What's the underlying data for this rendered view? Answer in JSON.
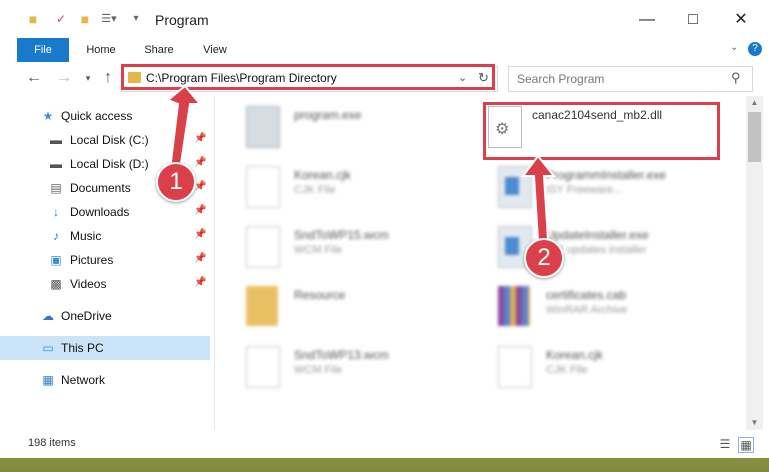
{
  "window": {
    "title": "Program"
  },
  "ribbon": {
    "tabs": [
      "File",
      "Home",
      "Share",
      "View"
    ]
  },
  "address": {
    "path": "C:\\Program Files\\Program Directory"
  },
  "search": {
    "placeholder": "Search Program"
  },
  "sidebar": {
    "items": [
      {
        "label": "Quick access",
        "icon": "star-icon"
      },
      {
        "label": "Local Disk (C:)",
        "icon": "drive-icon"
      },
      {
        "label": "Local Disk (D:)",
        "icon": "drive-icon"
      },
      {
        "label": "Documents",
        "icon": "document-icon"
      },
      {
        "label": "Downloads",
        "icon": "download-arrow-icon"
      },
      {
        "label": "Music",
        "icon": "music-note-icon"
      },
      {
        "label": "Pictures",
        "icon": "picture-icon"
      },
      {
        "label": "Videos",
        "icon": "video-icon"
      },
      {
        "label": "OneDrive",
        "icon": "cloud-icon"
      },
      {
        "label": "This PC",
        "icon": "monitor-icon"
      },
      {
        "label": "Network",
        "icon": "network-icon"
      }
    ]
  },
  "files": [
    {
      "name": "program.exe",
      "type": ""
    },
    {
      "name": "canac2104send_mb2.dll",
      "type": ""
    },
    {
      "name": "Korean.cjk",
      "type": "CJK File"
    },
    {
      "name": "ProgrammInstaller.exe",
      "type": "ISY Freeware..."
    },
    {
      "name": "SndToWP15.wcm",
      "type": "WCM File"
    },
    {
      "name": "UpdateInstaller.exe",
      "type": "ISY updates installer"
    },
    {
      "name": "Resource",
      "type": ""
    },
    {
      "name": "certificates.cab",
      "type": "WinRAR Archive"
    },
    {
      "name": "SndToWP13.wcm",
      "type": "WCM File"
    },
    {
      "name": "Korean.cjk",
      "type": "CJK File"
    }
  ],
  "annotations": {
    "step1": "1",
    "step2": "2"
  },
  "status": {
    "items_count": "198 items"
  },
  "colors": {
    "accent": "#1979ca",
    "highlight": "#d94049"
  }
}
